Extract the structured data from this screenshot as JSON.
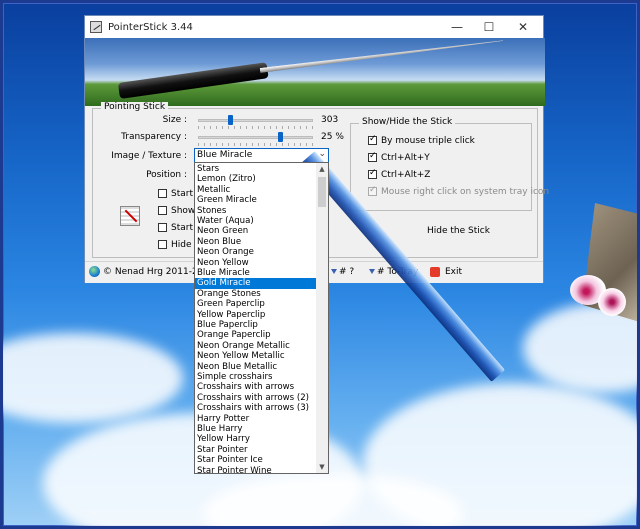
{
  "window": {
    "title": "PointerStick 3.44",
    "controls": {
      "minimize": "—",
      "maximize": "☐",
      "close": "✕"
    }
  },
  "pointing_stick": {
    "group_title": "Pointing Stick",
    "size_label": "Size :",
    "size_value": "303",
    "transparency_label": "Transparency :",
    "transparency_value": "25 %",
    "image_texture_label": "Image / Texture :",
    "image_texture_selected": "Blue Miracle",
    "position_label": "Position :",
    "checkboxes": [
      "Start w",
      "Show",
      "Start th",
      "Hide S"
    ]
  },
  "show_hide": {
    "group_title": "Show/Hide the Stick",
    "options": [
      {
        "label": "By mouse triple click",
        "checked": true,
        "disabled": false
      },
      {
        "label": "Ctrl+Alt+Y",
        "checked": true,
        "disabled": false
      },
      {
        "label": "Ctrl+Alt+Z",
        "checked": true,
        "disabled": false
      },
      {
        "label": "Mouse right click on system tray icon",
        "checked": true,
        "disabled": true
      }
    ],
    "hide_button": "Hide the Stick"
  },
  "statusbar": {
    "copyright": "© Nenad Hrg 2011-2019",
    "help": "# ?",
    "to_tray": "# To-Tray",
    "exit": "Exit"
  },
  "dropdown": {
    "selected_index": 11,
    "options": [
      "Stars",
      "Lemon (Zitro)",
      "Metallic",
      "Green Miracle",
      "Stones",
      "Water (Aqua)",
      "Neon Green",
      "Neon Blue",
      "Neon Orange",
      "Neon Yellow",
      "Blue Miracle",
      "Gold Miracle",
      "Orange Stones",
      "Green Paperclip",
      "Yellow Paperclip",
      "Blue Paperclip",
      "Orange Paperclip",
      "Neon Orange Metallic",
      "Neon Yellow Metallic",
      "Neon Blue Metallic",
      "Simple crosshairs",
      "Crosshairs with arrows",
      "Crosshairs with arrows (2)",
      "Crosshairs with arrows (3)",
      "Harry Potter",
      "Blue Harry",
      "Yellow Harry",
      "Star Pointer",
      "Star Pointer Ice",
      "Star Pointer Wine"
    ]
  },
  "colors": {
    "accent": "#0078d7",
    "desktop": "#1666c8",
    "frame": "#1c3a8f"
  }
}
